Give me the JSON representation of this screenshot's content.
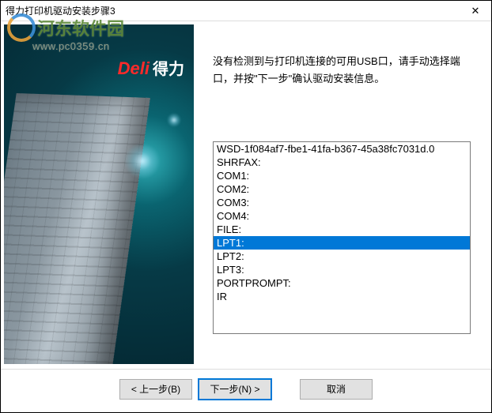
{
  "titlebar": {
    "title": "得力打印机驱动安装步骤3"
  },
  "watermark": {
    "text": "河东软件园",
    "url": "www.pc0359.cn"
  },
  "sidebar": {
    "brand_en": "Deli",
    "brand_cn": "得力"
  },
  "main": {
    "instruction": "没有检测到与打印机连接的可用USB口，请手动选择端口，并按\"下一步\"确认驱动安装信息。",
    "ports": [
      "WSD-1f084af7-fbe1-41fa-b367-45a38fc7031d.0",
      "SHRFAX:",
      "COM1:",
      "COM2:",
      "COM3:",
      "COM4:",
      "FILE:",
      "LPT1:",
      "LPT2:",
      "LPT3:",
      "PORTPROMPT:",
      "IR"
    ],
    "selected_index": 7
  },
  "buttons": {
    "back": "< 上一步(B)",
    "next": "下一步(N) >",
    "cancel": "取消"
  }
}
